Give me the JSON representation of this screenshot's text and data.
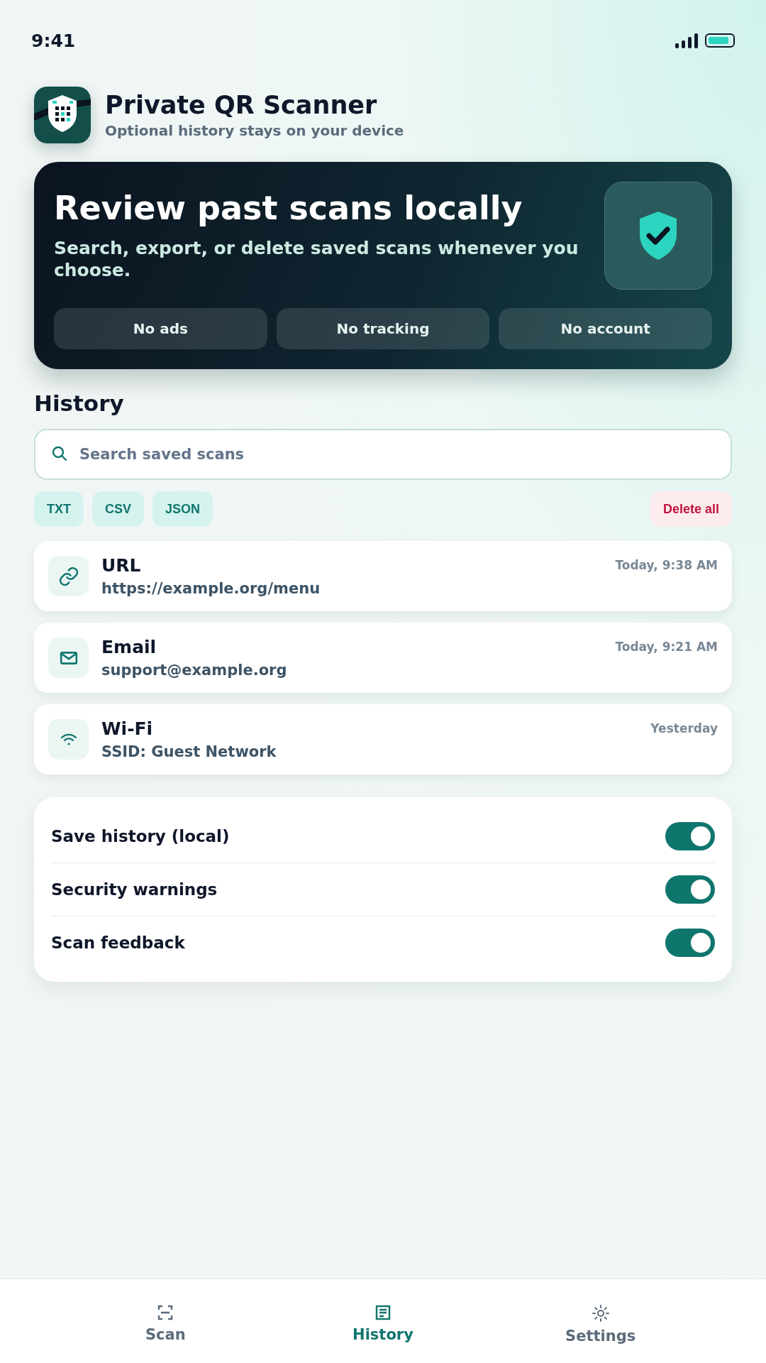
{
  "status_bar": {
    "time": "9:41"
  },
  "app": {
    "title": "Private QR Scanner",
    "subtitle": "Optional history stays on your device"
  },
  "hero": {
    "title": "Review past scans locally",
    "subtitle": "Search, export, or delete saved scans whenever you choose.",
    "badges": [
      "No ads",
      "No tracking",
      "No account"
    ]
  },
  "history": {
    "heading": "History",
    "search": {
      "placeholder": "Search saved scans"
    },
    "export_buttons": [
      "TXT",
      "CSV",
      "JSON"
    ],
    "delete_button": "Delete all",
    "items": [
      {
        "kind": "url",
        "type": "URL",
        "value": "https://example.org/menu",
        "time": "Today, 9:38 AM"
      },
      {
        "kind": "email",
        "type": "Email",
        "value": "support@example.org",
        "time": "Today, 9:21 AM"
      },
      {
        "kind": "wifi",
        "type": "Wi-Fi",
        "value": "SSID: Guest Network",
        "time": "Yesterday"
      }
    ]
  },
  "settings": [
    {
      "label": "Save history (local)",
      "on": true
    },
    {
      "label": "Security warnings",
      "on": true
    },
    {
      "label": "Scan feedback",
      "on": true
    }
  ],
  "tabs": [
    {
      "kind": "scan",
      "label": "Scan",
      "selected": false
    },
    {
      "kind": "history",
      "label": "History",
      "selected": true
    },
    {
      "kind": "settings",
      "label": "Settings",
      "selected": false
    }
  ]
}
